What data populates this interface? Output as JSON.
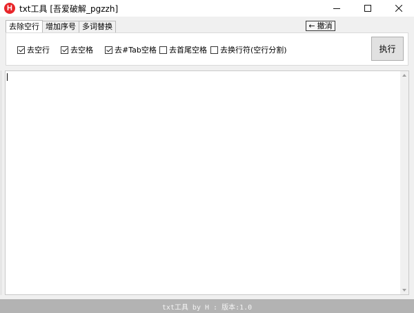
{
  "window": {
    "title": "txt工具 [吾爱破解_pgzzh]",
    "icon_letter": "H"
  },
  "tabs": [
    {
      "label": "去除空行",
      "active": true
    },
    {
      "label": "增加序号",
      "active": false
    },
    {
      "label": "多词替换",
      "active": false
    }
  ],
  "cancel_button": {
    "label": "撤消",
    "arrow": "←"
  },
  "options": [
    {
      "label": "去空行",
      "checked": true
    },
    {
      "label": "去空格",
      "checked": true
    },
    {
      "label": "去#Tab空格",
      "checked": true
    },
    {
      "label": "去首尾空格",
      "checked": false
    },
    {
      "label": "去换行符(空行分割)",
      "checked": false
    }
  ],
  "execute_button": {
    "label": "执行"
  },
  "editor": {
    "value": ""
  },
  "status": {
    "text": "txt工具 by H : 版本:1.0"
  },
  "colors": {
    "icon": "#e8262a",
    "status_bg": "#b3b3b3"
  }
}
